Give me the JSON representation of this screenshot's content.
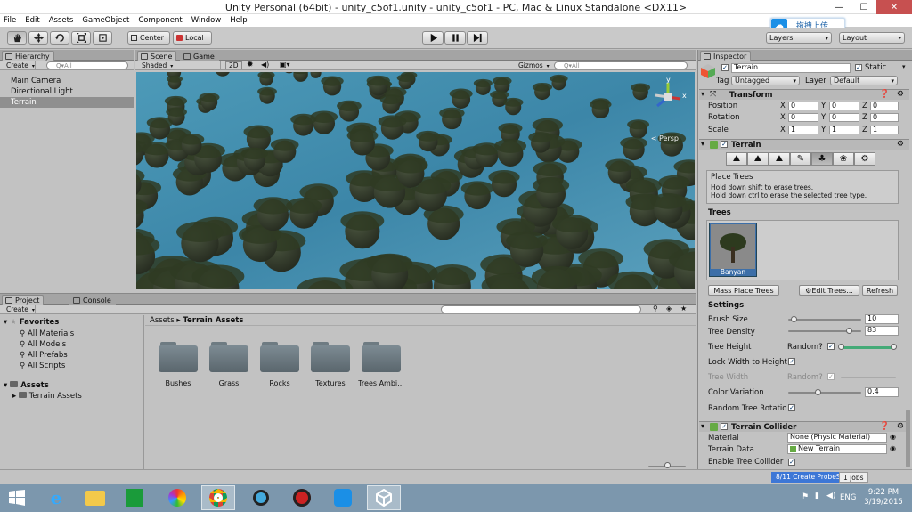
{
  "window": {
    "title": "Unity Personal (64bit) - unity_c5of1.unity - unity_c5of1 - PC, Mac & Linux Standalone <DX11>",
    "min": "—",
    "max": "☐",
    "close": "✕"
  },
  "menu": [
    "File",
    "Edit",
    "Assets",
    "GameObject",
    "Component",
    "Window",
    "Help"
  ],
  "toolbar": {
    "center": "Center",
    "local": "Local",
    "layers": "Layers",
    "layout": "Layout",
    "upload": "拖拽上传"
  },
  "hierarchy": {
    "tab": "Hierarchy",
    "create": "Create",
    "search": "Q▾All",
    "items": [
      "Main Camera",
      "Directional Light",
      "Terrain"
    ],
    "selected": 2
  },
  "scene": {
    "tab_scene": "Scene",
    "tab_game": "Game",
    "shaded": "Shaded",
    "mode2d": "2D",
    "gizmos": "Gizmos",
    "search": "Q▾All",
    "persp": "< Persp",
    "axis_y": "y",
    "axis_x": "x"
  },
  "project": {
    "tab": "Project",
    "tab_console": "Console",
    "create": "Create",
    "favorites_label": "Favorites",
    "favorites": [
      "All Materials",
      "All Models",
      "All Prefabs",
      "All Scripts"
    ],
    "assets_label": "Assets",
    "assets_children": [
      "Terrain Assets"
    ],
    "breadcrumb": [
      "Assets",
      "Terrain Assets"
    ],
    "folders": [
      "Bushes",
      "Grass",
      "Rocks",
      "Textures",
      "Trees Ambi..."
    ]
  },
  "inspector": {
    "tab": "Inspector",
    "object_name": "Terrain",
    "static": "Static",
    "tag_label": "Tag",
    "tag": "Untagged",
    "layer_label": "Layer",
    "layer": "Default",
    "transform": {
      "title": "Transform",
      "rows": [
        {
          "label": "Position",
          "x": "0",
          "y": "0",
          "z": "0"
        },
        {
          "label": "Rotation",
          "x": "0",
          "y": "0",
          "z": "0"
        },
        {
          "label": "Scale",
          "x": "1",
          "y": "1",
          "z": "1"
        }
      ],
      "xl": "X",
      "yl": "Y",
      "zl": "Z"
    },
    "terrain": {
      "title": "Terrain",
      "mode_title": "Place Trees",
      "help1": "Hold down shift to erase trees.",
      "help2": "Hold down ctrl to erase the selected tree type.",
      "trees_label": "Trees",
      "tree_name": "Banyan",
      "mass_place": "Mass Place Trees",
      "edit_trees": "Edit Trees...",
      "refresh": "Refresh",
      "settings": "Settings",
      "brush_size_label": "Brush Size",
      "brush_size": "10",
      "tree_density_label": "Tree Density",
      "tree_density": "83",
      "tree_height_label": "Tree Height",
      "random_label": "Random?",
      "lock_width_label": "Lock Width to Height",
      "tree_width_label": "Tree Width",
      "color_var_label": "Color Variation",
      "color_var": "0.4",
      "random_rot_label": "Random Tree Rotatio",
      "brush_size_level": 0.07,
      "tree_density_level": 0.83,
      "color_var_level": 0.4
    },
    "collider": {
      "title": "Terrain Collider",
      "material_label": "Material",
      "material": "None (Physic Material)",
      "data_label": "Terrain Data",
      "data": "New Terrain",
      "enable_label": "Enable Tree Collider"
    }
  },
  "status": {
    "probe": "8/11 Create ProbeSet",
    "jobs": "1 jobs"
  },
  "taskbar": {
    "lang": "ENG",
    "time": "9:22 PM",
    "date": "3/19/2015"
  },
  "colors": {
    "water": "#3f8fb0",
    "tree": "#2f3b23",
    "selection": "#3d6fa8"
  }
}
